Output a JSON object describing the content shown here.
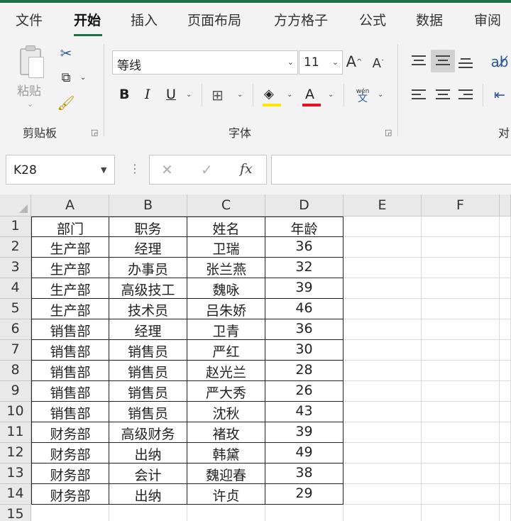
{
  "ribbon": {
    "tabs": [
      "文件",
      "开始",
      "插入",
      "页面布局",
      "方方格子",
      "公式",
      "数据",
      "审阅"
    ],
    "active_tab": "开始",
    "clipboard": {
      "paste_label": "粘贴",
      "group_label": "剪贴板"
    },
    "font": {
      "name": "等线",
      "size": "11",
      "group_label": "字体",
      "phonetic_label": "wén"
    },
    "alignment": {
      "group_label_partial": "对"
    },
    "colors": {
      "accent": "#1e7145",
      "highlight": "#ffe600",
      "font_color": "#e81123"
    }
  },
  "formula_bar": {
    "name_box": "K28",
    "cancel_icon": "✕",
    "enter_icon": "✓",
    "fx_label": "fx",
    "formula": ""
  },
  "sheet": {
    "columns": [
      "A",
      "B",
      "C",
      "D",
      "E",
      "F"
    ],
    "rows": [
      "1",
      "2",
      "3",
      "4",
      "5",
      "6",
      "7",
      "8",
      "9",
      "10",
      "11",
      "12",
      "13",
      "14",
      "15"
    ],
    "cells": [
      [
        "部门",
        "职务",
        "姓名",
        "年龄"
      ],
      [
        "生产部",
        "经理",
        "卫瑞",
        "36"
      ],
      [
        "生产部",
        "办事员",
        "张兰燕",
        "32"
      ],
      [
        "生产部",
        "高级技工",
        "魏咏",
        "39"
      ],
      [
        "生产部",
        "技术员",
        "吕朱娇",
        "46"
      ],
      [
        "销售部",
        "经理",
        "卫青",
        "36"
      ],
      [
        "销售部",
        "销售员",
        "严红",
        "30"
      ],
      [
        "销售部",
        "销售员",
        "赵光兰",
        "28"
      ],
      [
        "销售部",
        "销售员",
        "严大秀",
        "26"
      ],
      [
        "销售部",
        "销售员",
        "沈秋",
        "43"
      ],
      [
        "财务部",
        "高级财务",
        "褚玫",
        "39"
      ],
      [
        "财务部",
        "出纳",
        "韩黛",
        "49"
      ],
      [
        "财务部",
        "会计",
        "魏迎春",
        "38"
      ],
      [
        "财务部",
        "出纳",
        "许贞",
        "29"
      ]
    ]
  }
}
